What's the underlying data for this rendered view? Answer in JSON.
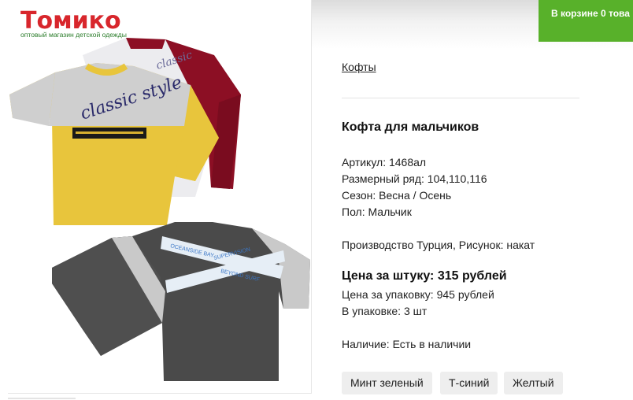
{
  "header": {
    "logo_text": "Томико",
    "logo_tagline": "оптовый магазин детской одежды",
    "cart_prefix": "В корзине ",
    "cart_count": "0",
    "cart_suffix": " това"
  },
  "breadcrumb": {
    "label": "Кофты"
  },
  "product": {
    "title": "Кофта для мальчиков",
    "article": "Артикул: 1468ал",
    "sizes": "Размерный ряд: 104,110,116",
    "season": "Сезон: Весна / Осень",
    "gender": "Пол: Мальчик",
    "production": "Производство Турция, Рисунок: накат",
    "price_unit": "Цена за штуку: 315 рублей",
    "price_pack": "Цена за упаковку: 945 рублей",
    "pack_qty": "В упаковке: 3 шт",
    "availability": "Наличие: Есть в наличии"
  },
  "color_options": [
    "Минт зеленый",
    "Т-синий",
    "Желтый"
  ],
  "image": {
    "print_top": "classic style",
    "print_bottom_1": "OCEANSIDE BAY",
    "print_bottom_2": "SUPERVISION",
    "print_bottom_3": "BEYOND SURF"
  },
  "colors": {
    "cart_bg": "#58b12a",
    "shirt_yellow": "#e8c53c",
    "shirt_burgundy": "#8c0f24",
    "shirt_grey": "#4a4a4a",
    "sleeve_light": "#c9c9c9"
  }
}
